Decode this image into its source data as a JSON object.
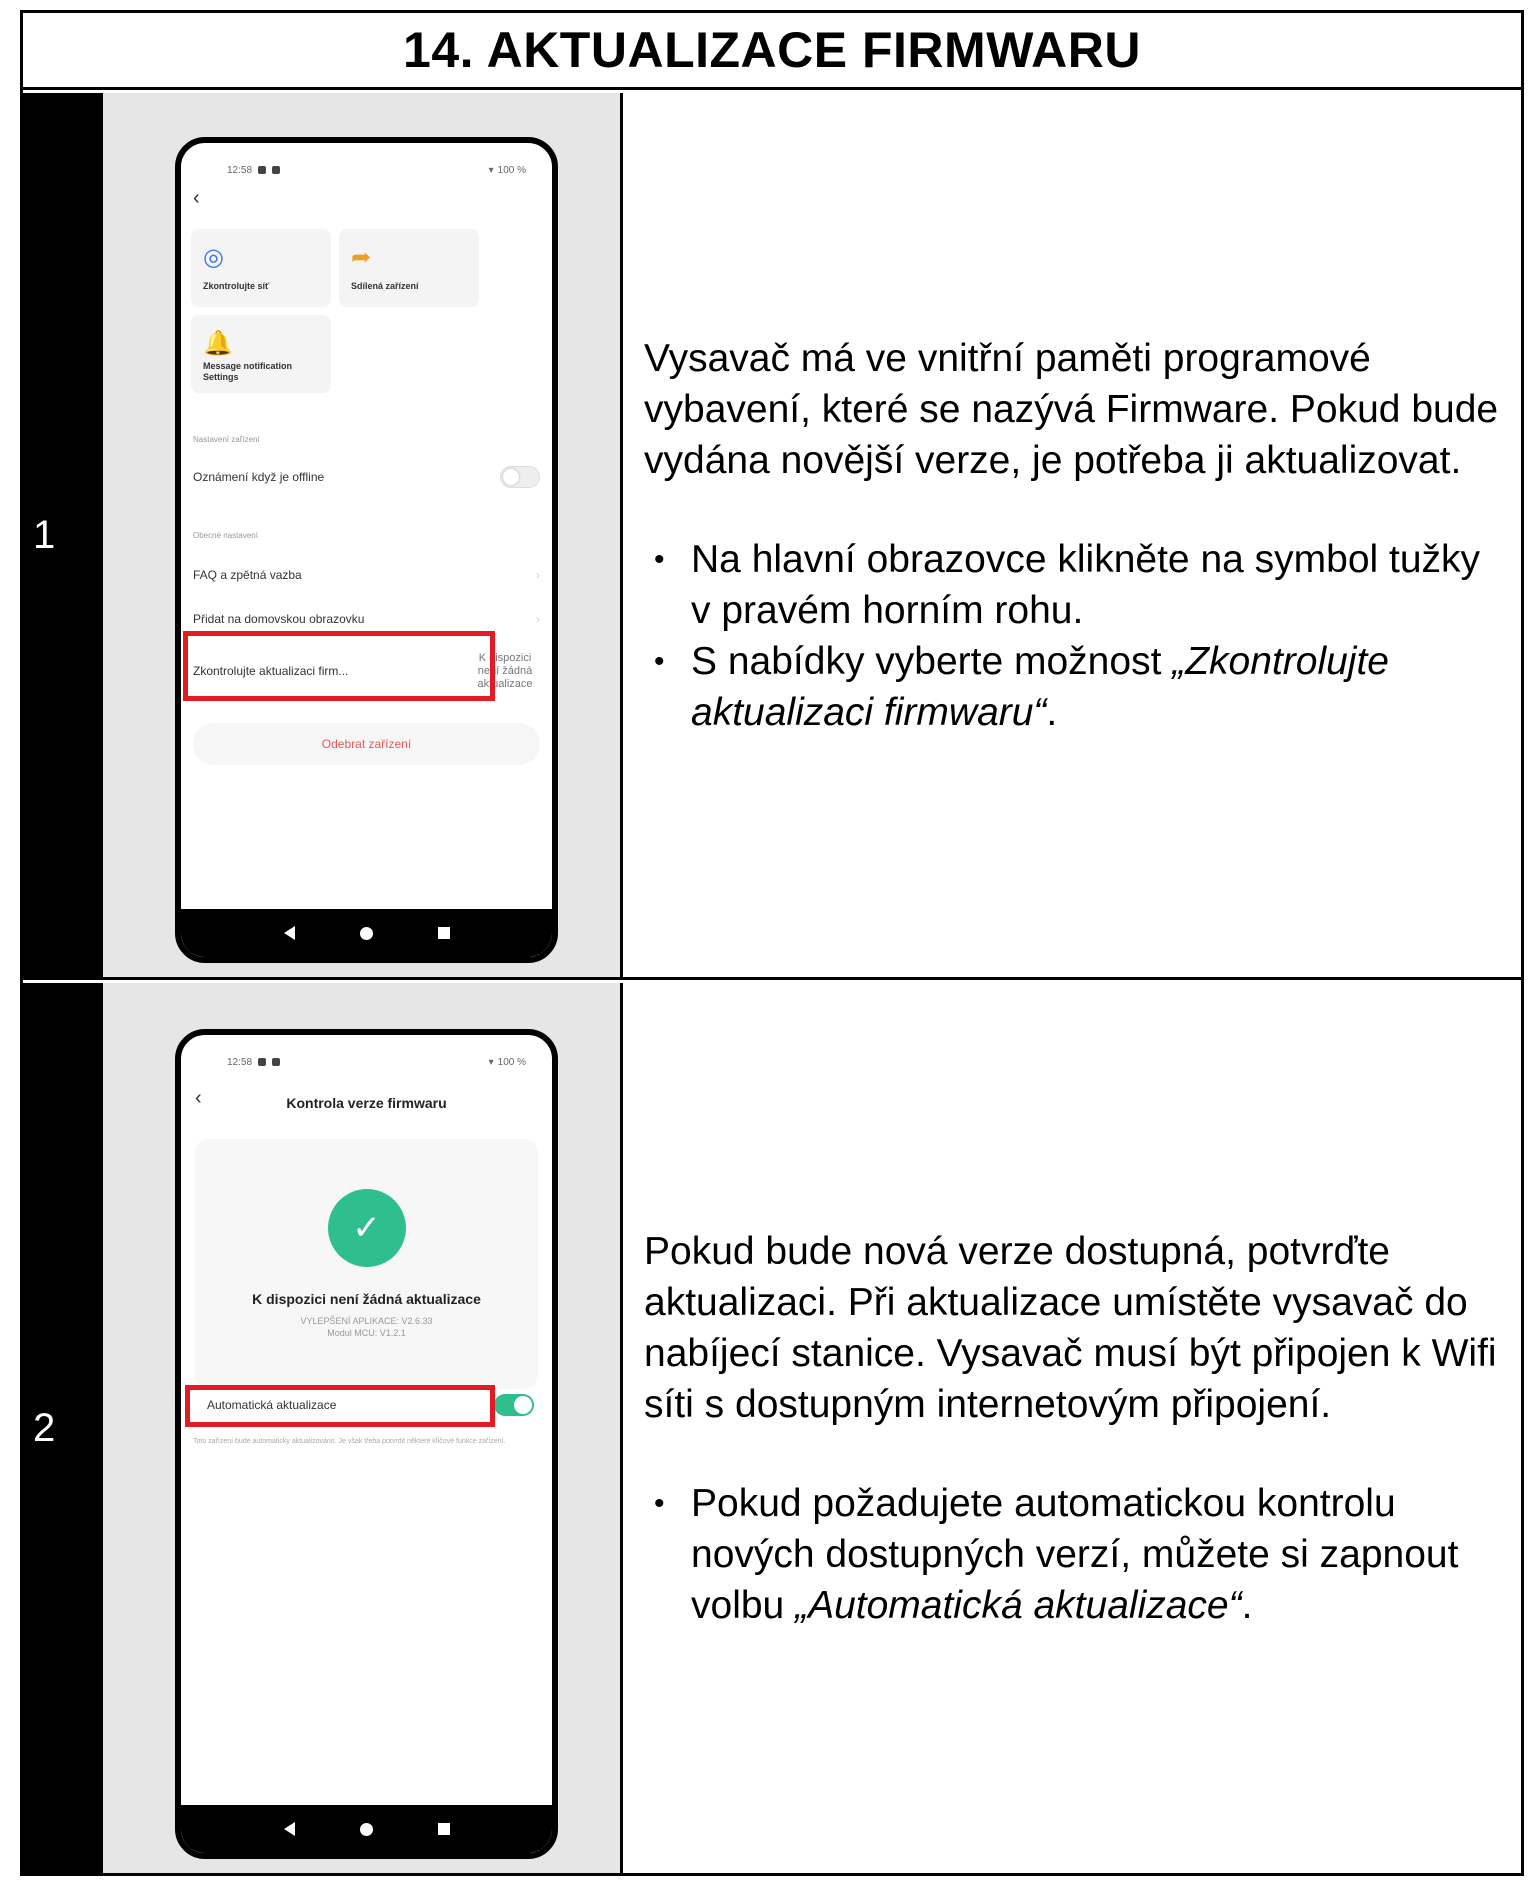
{
  "title": "14. AKTUALIZACE FIRMWARU",
  "steps": [
    {
      "number": "1",
      "intro": "Vysavač má ve vnitřní paměti programové vybavení, které se nazývá Firmware. Pokud bude vydána novější verze, je potřeba ji aktualizovat.",
      "bullet1": "Na hlavní obrazovce klikněte na symbol tužky v pravém horním rohu.",
      "bullet2_prefix": "S nabídky vyberte možnost ",
      "bullet2_italic": "„Zkontrolujte aktualizaci firmwaru“",
      "bullet2_suffix": ".",
      "phone": {
        "time": "12:58",
        "battery": "100 %",
        "tile1_label": "Zkontrolujte síť",
        "tile2_label": "Sdílená zařízení",
        "tile3_label": "Message notification Settings",
        "section1": "Nastavení zařízení",
        "offline_label": "Oznámení když je offline",
        "section2": "Obecné nastavení",
        "faq_label": "FAQ a zpětná vazba",
        "home_label": "Přidat na domovskou obrazovku",
        "firmware_label": "Zkontrolujte aktualizaci firm...",
        "firmware_status": "K dispozici není žádná aktualizace",
        "remove_label": "Odebrat zařízení"
      }
    },
    {
      "number": "2",
      "intro": "Pokud bude nová verze dostupná, potvrďte aktualizaci. Při aktualizace umístěte vysavač do nabíjecí stanice. Vysavač musí být připojen k Wifi síti s dostupným internetovým připojení.",
      "bullet1_prefix": "Pokud požadujete automatickou kontrolu nových dostupných verzí, můžete si zapnout volbu ",
      "bullet1_italic": "„Automatická aktualizace“",
      "bullet1_suffix": ".",
      "phone": {
        "time": "12:58",
        "battery": "100 %",
        "screen_title": "Kontrola verze firmwaru",
        "no_update": "K dispozici není žádná aktualizace",
        "app_version": "VYLEPŠENÍ APLIKACE: V2.6.33",
        "mcu_version": "Modul MCU: V1.2.1",
        "auto_update_label": "Automatická aktualizace",
        "note": "Toto zařízení bude automaticky aktualizováno. Je však třeba potvrdit některé klíčové funkce zařízení."
      }
    }
  ],
  "icons": {
    "back": "chevron-left-icon",
    "network": "network-check-icon",
    "share": "share-arrow-icon",
    "bell": "bell-icon",
    "check": "check-icon"
  },
  "colors": {
    "highlight": "#e31b23",
    "toggle_on": "#2fbf8f",
    "network_icon": "#3b78e7",
    "share_icon": "#f0a020",
    "bell_icon": "#3b78e7",
    "remove_text": "#e85a5a"
  }
}
